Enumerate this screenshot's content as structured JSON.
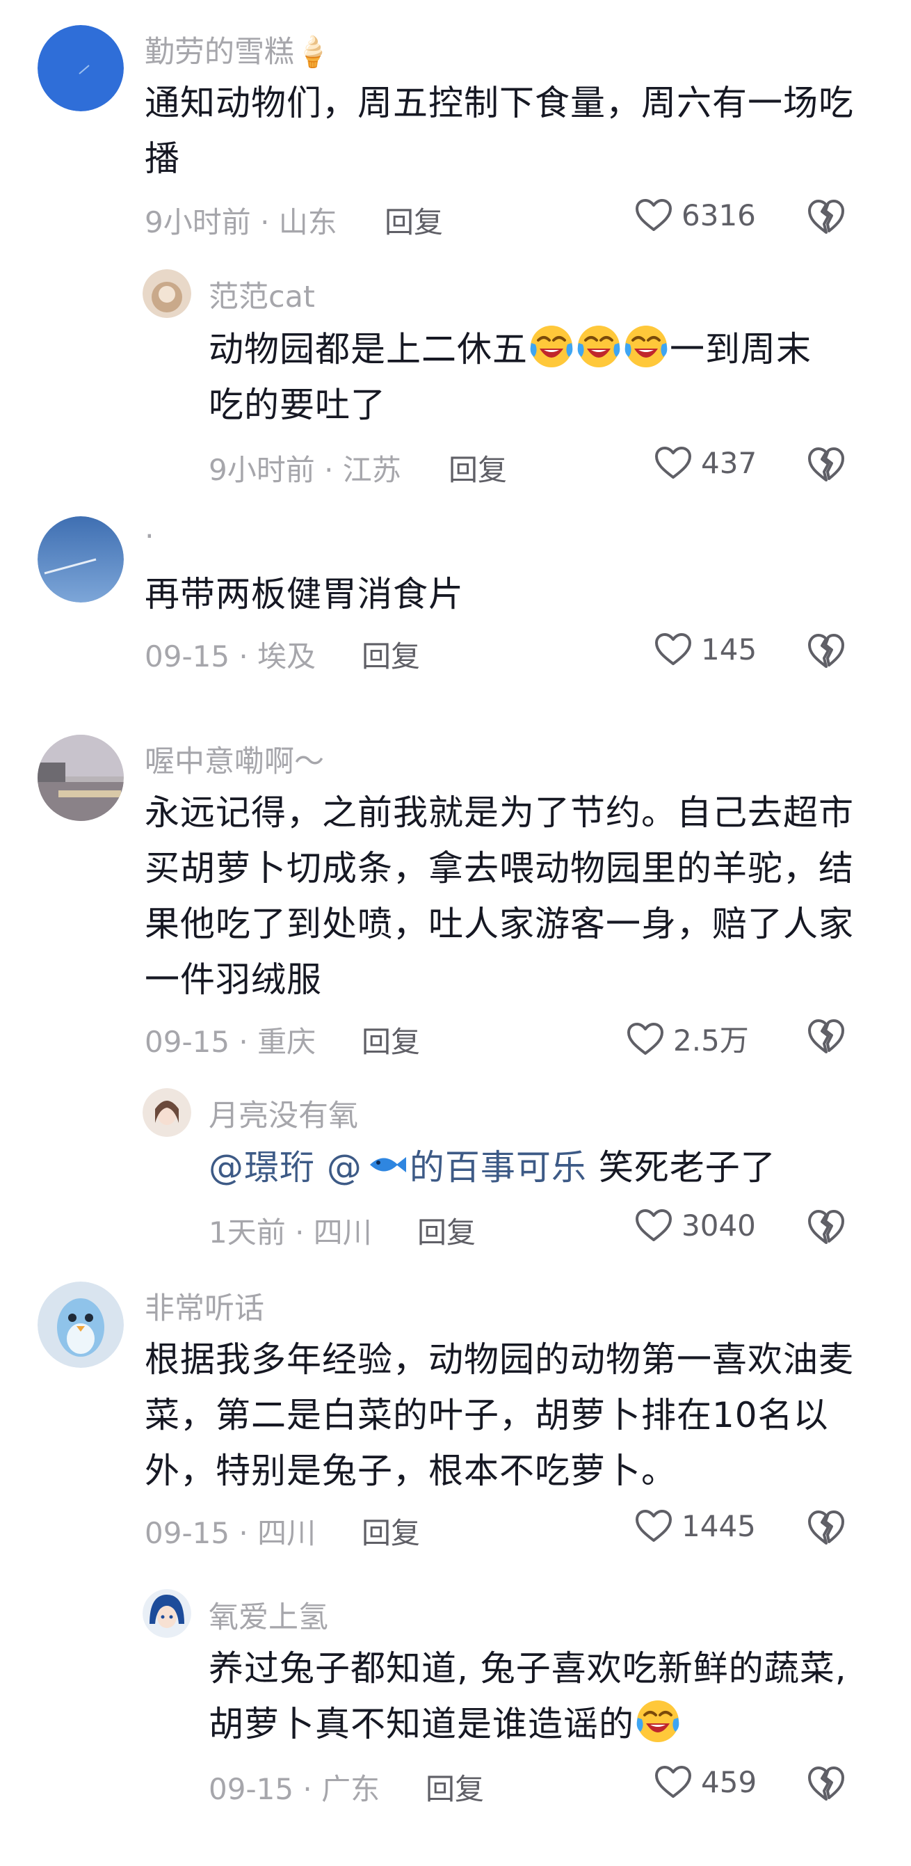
{
  "comments": [
    {
      "user": "勤劳的雪糕🍦",
      "text": "通知动物们，周五控制下食量，周六有一场吃播",
      "text_line1": "通知动物们，周五控制下食量，周六有一场吃",
      "text_line2": "播",
      "time": "9小时前",
      "location": "山东",
      "reply_label": "回复",
      "likes": "6316",
      "replies": [
        {
          "user": "范范cat",
          "text_before": "动物园都是上二休五",
          "text_after": "一到周末",
          "text_line2": "吃的要吐了",
          "emoji": "crying-laughing-emoji",
          "time": "9小时前",
          "location": "江苏",
          "reply_label": "回复",
          "likes": "437"
        }
      ]
    },
    {
      "user": "·",
      "text": "再带两板健胃消食片",
      "time": "09-15",
      "location": "埃及",
      "reply_label": "回复",
      "likes": "145"
    },
    {
      "user": "喔中意嘞啊～",
      "text_line1": "永远记得，之前我就是为了节约。自己去超市",
      "text_line2": "买胡萝卜切成条，拿去喂动物园里的羊驼，结",
      "text_line3": "果他吃了到处喷，吐人家游客一身，赔了人家",
      "text_line4": "一件羽绒服",
      "time": "09-15",
      "location": "重庆",
      "reply_label": "回复",
      "likes": "2.5万",
      "replies": [
        {
          "user": "月亮没有氧",
          "mention1": "@璟珩",
          "mention2_prefix": "@",
          "mention2_suffix": "的百事可乐",
          "fish_emoji": "fish-emoji",
          "text": "笑死老子了",
          "time": "1天前",
          "location": "四川",
          "reply_label": "回复",
          "likes": "3040"
        }
      ]
    },
    {
      "user": "非常听话",
      "text_line1": "根据我多年经验，动物园的动物第一喜欢油麦",
      "text_line2": "菜，第二是白菜的叶子，胡萝卜排在10名以",
      "text_line3": "外，特别是兔子，根本不吃萝卜。",
      "time": "09-15",
      "location": "四川",
      "reply_label": "回复",
      "likes": "1445",
      "replies": [
        {
          "user": "氧爱上氢",
          "text_line1": "养过兔子都知道, 兔子喜欢吃新鲜的蔬菜,",
          "text_line2_before": "胡萝卜真不知道是谁造谣的",
          "emoji": "crying-laughing-emoji",
          "time": "09-15",
          "location": "广东",
          "reply_label": "回复",
          "likes": "459"
        }
      ]
    }
  ],
  "separator": " · ",
  "colors": {
    "text": "#161823",
    "meta": "#a6a6ab",
    "mention": "#3d5a86"
  }
}
